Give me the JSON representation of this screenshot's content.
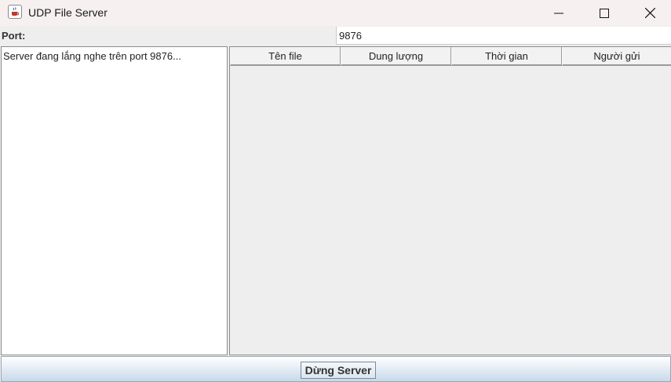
{
  "window": {
    "title": "UDP File Server",
    "icon": "java-cup-icon"
  },
  "controls": {
    "minimize": "minimize-icon",
    "maximize": "maximize-icon",
    "close": "close-icon"
  },
  "port": {
    "label": "Port:",
    "value": "9876"
  },
  "log": {
    "lines": [
      "Server đang lắng nghe trên port 9876..."
    ]
  },
  "table": {
    "columns": [
      "Tên file",
      "Dung lượng",
      "Thời gian",
      "Người gửi"
    ],
    "rows": []
  },
  "footer": {
    "stop_button": "Dừng Server"
  }
}
